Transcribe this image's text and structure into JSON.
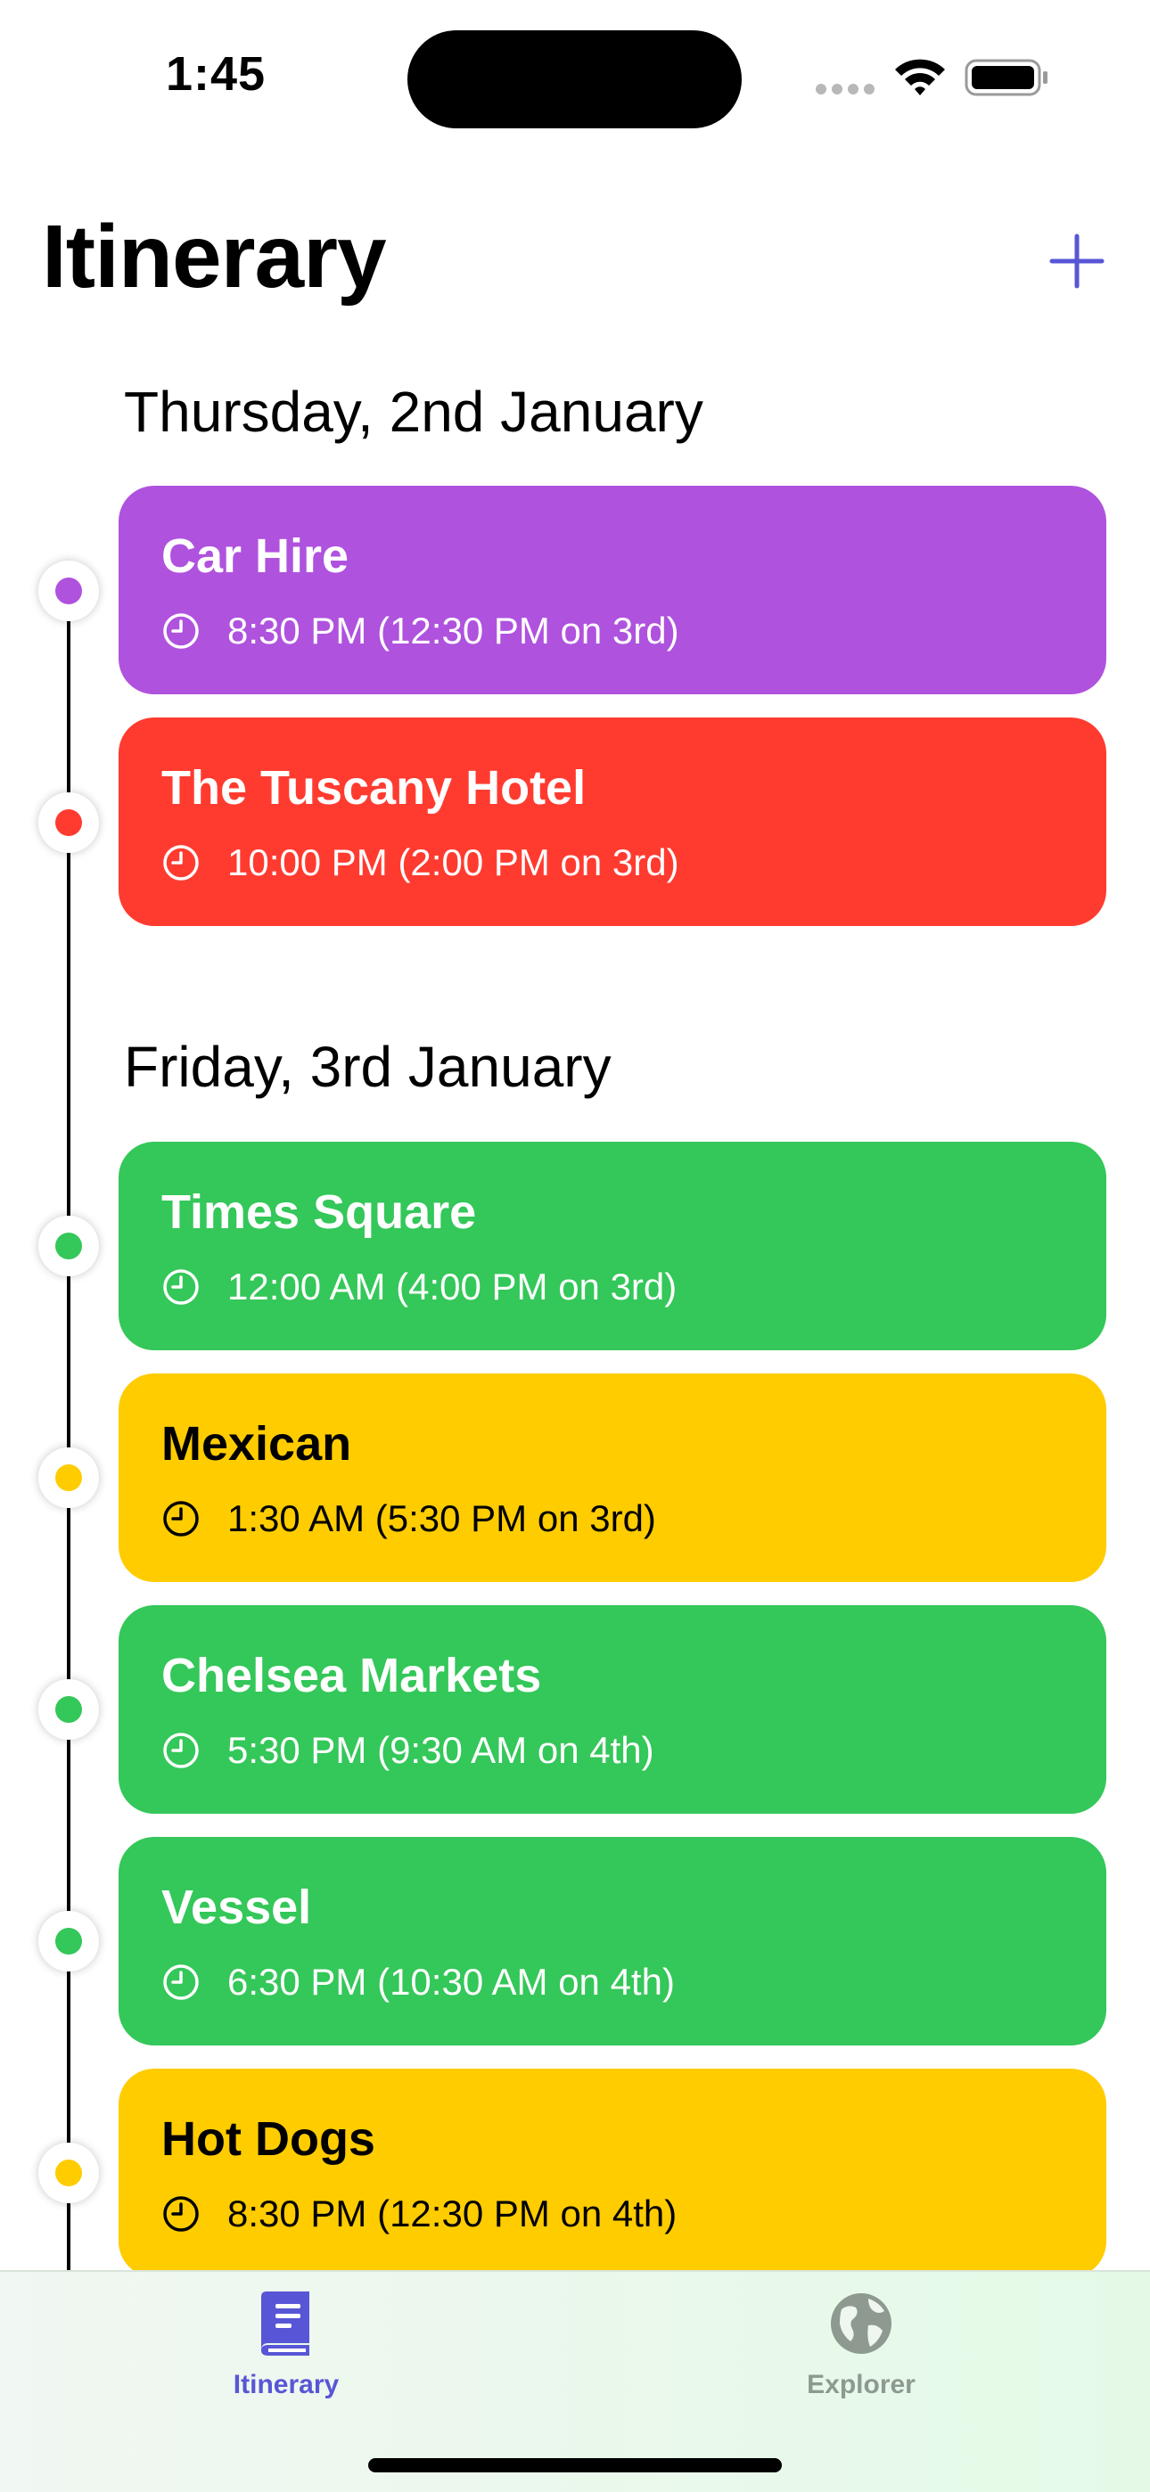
{
  "status_bar": {
    "time": "1:45"
  },
  "header": {
    "title": "Itinerary",
    "add_icon": "plus-icon"
  },
  "days": [
    {
      "heading": "Thursday, 2nd January",
      "events": [
        {
          "title": "Car Hire",
          "time": "8:30 PM (12:30 PM on 3rd)",
          "color": "#AF52DE",
          "text_color": "#FFFFFF"
        },
        {
          "title": "The Tuscany Hotel",
          "time": "10:00 PM (2:00 PM on 3rd)",
          "color": "#FF3B30",
          "text_color": "#FFFFFF"
        }
      ]
    },
    {
      "heading": "Friday, 3rd January",
      "events": [
        {
          "title": "Times Square",
          "time": "12:00 AM (4:00 PM on 3rd)",
          "color": "#34C759",
          "text_color": "#FFFFFF"
        },
        {
          "title": "Mexican",
          "time": "1:30 AM (5:30 PM on 3rd)",
          "color": "#FFCC00",
          "text_color": "#000000"
        },
        {
          "title": "Chelsea Markets",
          "time": "5:30 PM (9:30 AM on 4th)",
          "color": "#34C759",
          "text_color": "#FFFFFF"
        },
        {
          "title": "Vessel",
          "time": "6:30 PM (10:30 AM on 4th)",
          "color": "#34C759",
          "text_color": "#FFFFFF"
        },
        {
          "title": "Hot Dogs",
          "time": "8:30 PM (12:30 PM on 4th)",
          "color": "#FFCC00",
          "text_color": "#000000"
        }
      ]
    }
  ],
  "tab_bar": {
    "tabs": [
      {
        "label": "Itinerary",
        "icon": "book-icon",
        "selected": true,
        "color": "#5856D6"
      },
      {
        "label": "Explorer",
        "icon": "globe-icon",
        "selected": false,
        "color": "#8E9A90"
      }
    ]
  },
  "colors": {
    "accent": "#5856D6",
    "purple": "#AF52DE",
    "red": "#FF3B30",
    "green": "#34C759",
    "yellow": "#FFCC00"
  }
}
